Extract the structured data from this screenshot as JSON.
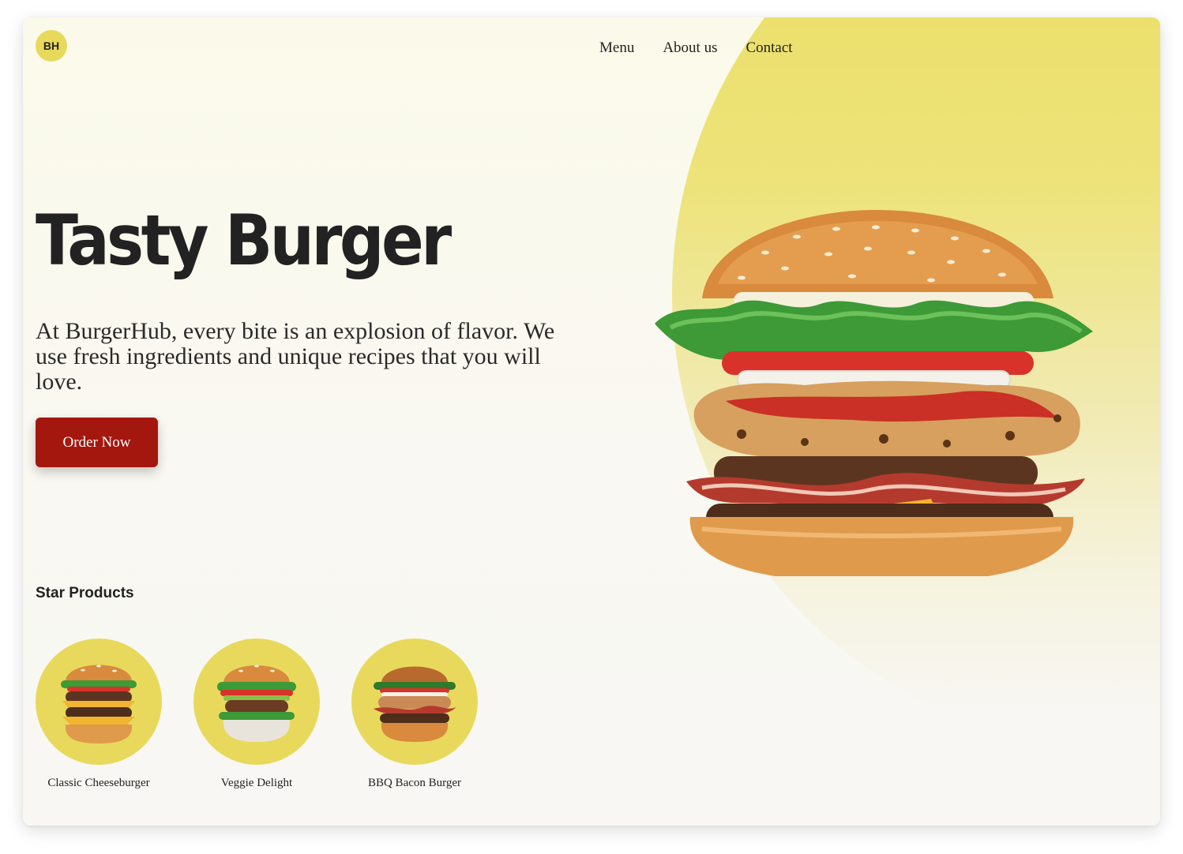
{
  "brand": {
    "logo_text": "BH"
  },
  "nav": {
    "items": [
      "Menu",
      "About us",
      "Contact"
    ]
  },
  "hero": {
    "title": "Tasty Burger",
    "description": "At BurgerHub, every bite is an explosion of flavor. We use fresh ingredients and unique recipes that you will love.",
    "cta_label": "Order Now",
    "image_icon": "burger-image"
  },
  "star_products": {
    "title": "Star Products",
    "items": [
      {
        "name": "Classic Cheeseburger",
        "icon": "cheeseburger-image"
      },
      {
        "name": "Veggie Delight",
        "icon": "veggie-burger-image"
      },
      {
        "name": "BBQ Bacon Burger",
        "icon": "bacon-burger-image"
      }
    ]
  },
  "colors": {
    "accent_yellow": "#e8d95c",
    "button_red": "#a4170f",
    "text_dark": "#222222",
    "background": "#f9f8f2"
  }
}
